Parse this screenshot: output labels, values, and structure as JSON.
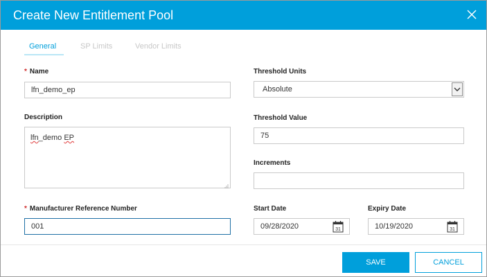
{
  "dialog": {
    "title": "Create New Entitlement Pool",
    "close_icon": "close-icon"
  },
  "tabs": [
    {
      "label": "General",
      "active": true
    },
    {
      "label": "SP Limits",
      "active": false
    },
    {
      "label": "Vendor Limits",
      "active": false
    }
  ],
  "form": {
    "name": {
      "label": "Name",
      "required": true,
      "value": "lfn_demo_ep"
    },
    "description": {
      "label": "Description",
      "value_word1": "lfn",
      "value_sep": "_demo ",
      "value_word2": "EP"
    },
    "manufacturer_ref": {
      "label": "Manufacturer Reference Number",
      "required": true,
      "value": "001"
    },
    "threshold_units": {
      "label": "Threshold Units",
      "value": "Absolute"
    },
    "threshold_value": {
      "label": "Threshold Value",
      "value": "75"
    },
    "increments": {
      "label": "Increments",
      "value": ""
    },
    "start_date": {
      "label": "Start Date",
      "value": "09/28/2020",
      "icon": "calendar-icon"
    },
    "expiry_date": {
      "label": "Expiry Date",
      "value": "10/19/2020",
      "icon": "calendar-icon"
    },
    "required_marker": "*"
  },
  "calendar_day": "31",
  "buttons": {
    "save": "SAVE",
    "cancel": "CANCEL"
  },
  "colors": {
    "accent": "#009fdb",
    "required": "#cf2a2a",
    "focus_border": "#1d6fa5"
  }
}
